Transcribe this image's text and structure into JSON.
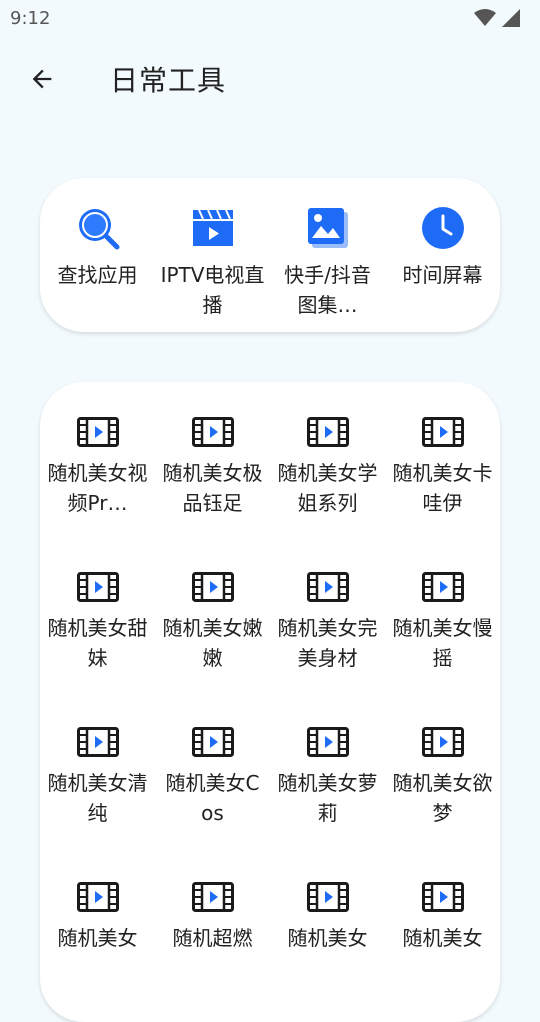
{
  "status": {
    "time": "9:12"
  },
  "header": {
    "title": "日常工具",
    "back_icon": "arrow-left-icon"
  },
  "quick_tools": [
    {
      "label": "查找应用",
      "icon": "search-icon"
    },
    {
      "label": "IPTV电视直播",
      "icon": "clapperboard-icon"
    },
    {
      "label": "快手/抖音图集…",
      "icon": "image-gallery-icon"
    },
    {
      "label": "时间屏幕",
      "icon": "clock-icon"
    }
  ],
  "video_tools": [
    {
      "label": "随机美女视频Pr…"
    },
    {
      "label": "随机美女极品钰足"
    },
    {
      "label": "随机美女学姐系列"
    },
    {
      "label": "随机美女卡哇伊"
    },
    {
      "label": "随机美女甜妹"
    },
    {
      "label": "随机美女嫩嫩"
    },
    {
      "label": "随机美女完美身材"
    },
    {
      "label": "随机美女慢摇"
    },
    {
      "label": "随机美女清纯"
    },
    {
      "label": "随机美女Cos"
    },
    {
      "label": "随机美女萝莉"
    },
    {
      "label": "随机美女欲梦"
    },
    {
      "label": "随机美女"
    },
    {
      "label": "随机超燃"
    },
    {
      "label": "随机美女"
    },
    {
      "label": "随机美女"
    }
  ],
  "colors": {
    "accent": "#1e6cf5",
    "icon_dark": "#1a1a1a",
    "background": "#f2fafe"
  }
}
